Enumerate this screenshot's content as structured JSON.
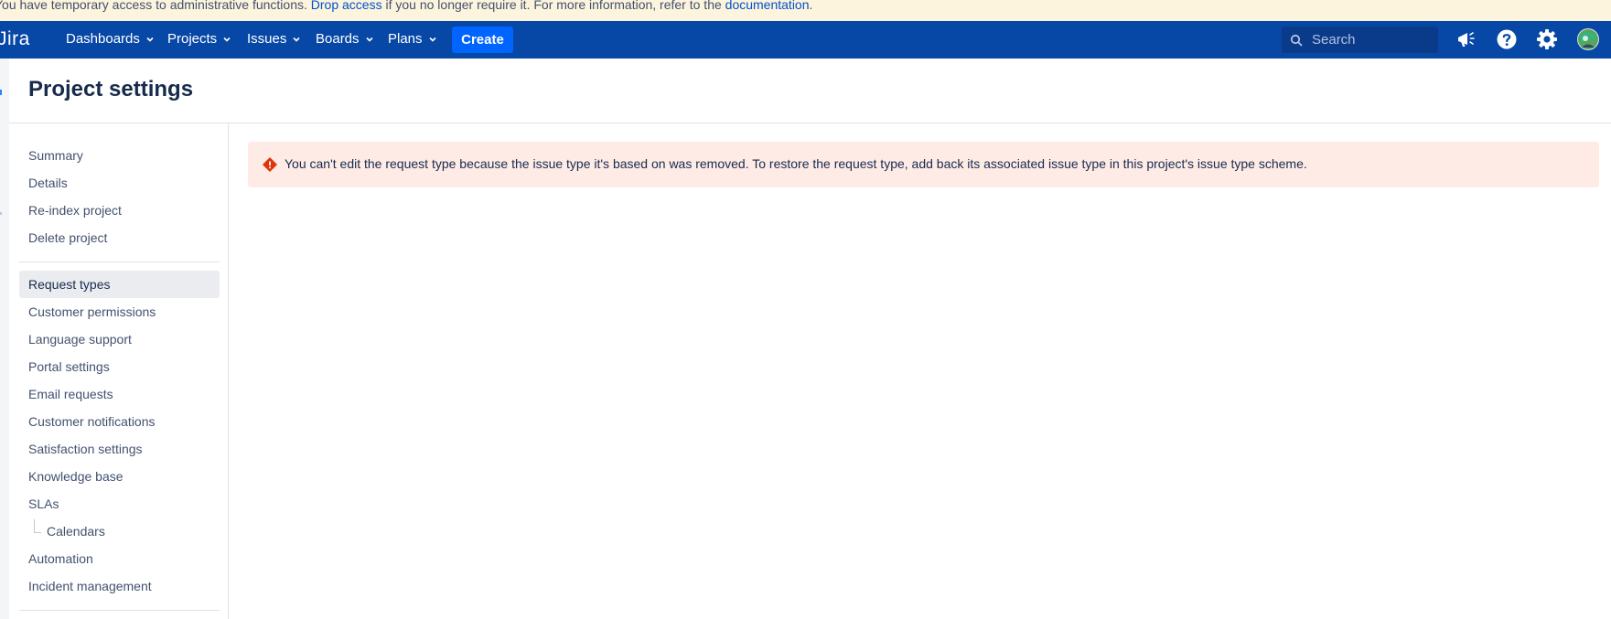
{
  "banner": {
    "text_before": "You have temporary access to administrative functions. ",
    "drop_access_link": "Drop access",
    "text_middle": " if you no longer require it. For more information, refer to the ",
    "documentation_link": "documentation",
    "text_after": "."
  },
  "topnav": {
    "logo": "Jira",
    "items": [
      {
        "label": "Dashboards"
      },
      {
        "label": "Projects"
      },
      {
        "label": "Issues"
      },
      {
        "label": "Boards"
      },
      {
        "label": "Plans"
      }
    ],
    "create_label": "Create",
    "search_placeholder": "Search",
    "icons": [
      "megaphone-icon",
      "help-icon",
      "settings-icon",
      "avatar"
    ]
  },
  "page": {
    "title": "Project settings"
  },
  "sidebar": {
    "group1": [
      {
        "label": "Summary"
      },
      {
        "label": "Details"
      },
      {
        "label": "Re-index project"
      },
      {
        "label": "Delete project"
      }
    ],
    "group2": [
      {
        "label": "Request types",
        "selected": true
      },
      {
        "label": "Customer permissions"
      },
      {
        "label": "Language support"
      },
      {
        "label": "Portal settings"
      },
      {
        "label": "Email requests"
      },
      {
        "label": "Customer notifications"
      },
      {
        "label": "Satisfaction settings"
      },
      {
        "label": "Knowledge base"
      },
      {
        "label": "SLAs"
      },
      {
        "label": "Calendars",
        "sub": true
      },
      {
        "label": "Automation"
      },
      {
        "label": "Incident management"
      }
    ]
  },
  "error": {
    "message": "You can't edit the request type because the issue type it's based on was removed. To restore the request type, add back its associated issue type in this project's issue type scheme."
  },
  "colors": {
    "nav_bg": "#0747a6",
    "create_btn": "#0065ff",
    "banner_bg": "#fdf4dd",
    "error_bg": "#ffebe6",
    "error_icon": "#de350b",
    "link": "#0052cc"
  }
}
